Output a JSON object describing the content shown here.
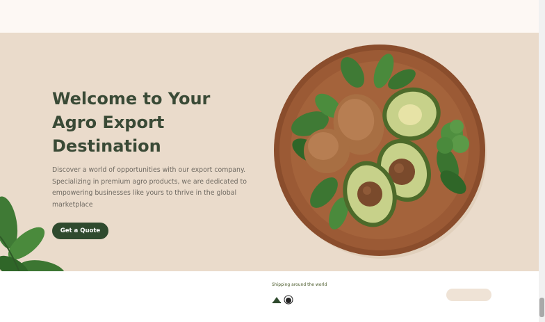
{
  "hero": {
    "headline_lines": [
      "Welcome to Your",
      "Agro Export",
      "Destination"
    ],
    "description_lines": [
      "Discover a world of opportunities with our export company.",
      "Specializing in premium agro products, we are dedicated to",
      "empowering businesses like yours to thrive in the global",
      "marketplace"
    ],
    "cta_label": "Get a Quote"
  },
  "bottom": {
    "label": "Shipping around the world"
  },
  "colors": {
    "hero_bg": "#eadbcb",
    "heading": "#3a4a36",
    "accent": "#2f4a2e",
    "page_bg": "#fdf8f3"
  },
  "icons": [
    "avocado-plate-image",
    "basil-leaves-image",
    "shipping-icon",
    "globe-icon"
  ]
}
